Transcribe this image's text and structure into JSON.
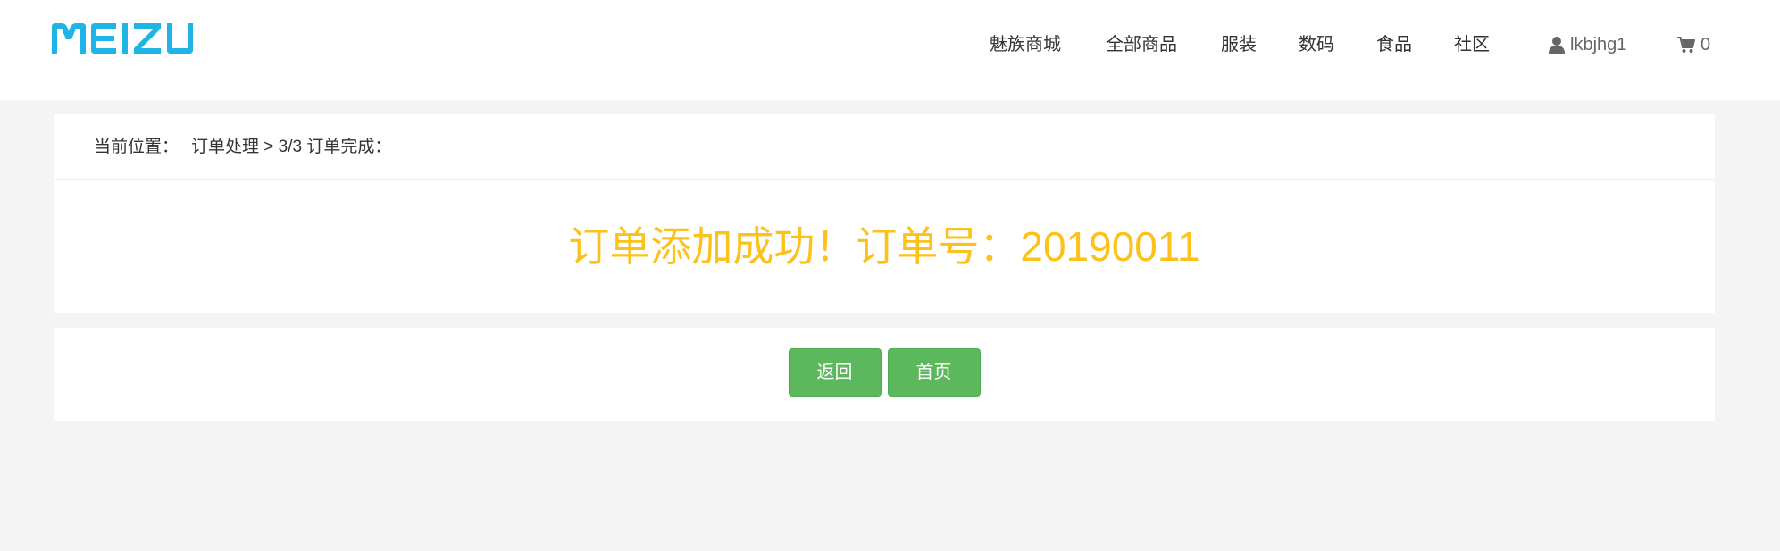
{
  "header": {
    "logo_text": "MEIZU",
    "nav": [
      {
        "label": "魅族商城"
      },
      {
        "label": "全部商品"
      },
      {
        "label": "服装"
      },
      {
        "label": "数码"
      },
      {
        "label": "食品"
      },
      {
        "label": "社区"
      }
    ],
    "user": {
      "name": "lkbjhg1",
      "icon": "user-icon"
    },
    "cart": {
      "count": "0",
      "icon": "cart-icon"
    }
  },
  "breadcrumb": {
    "prefix": "当前位置：",
    "path": "订单处理 > 3/3 订单完成："
  },
  "result": {
    "message": "订单添加成功！订单号：20190011"
  },
  "actions": {
    "back_label": "返回",
    "home_label": "首页"
  },
  "colors": {
    "brand": "#1fb3e6",
    "success_text": "#fcc21b",
    "button_green": "#5cb85c",
    "page_bg": "#f4f4f4"
  }
}
